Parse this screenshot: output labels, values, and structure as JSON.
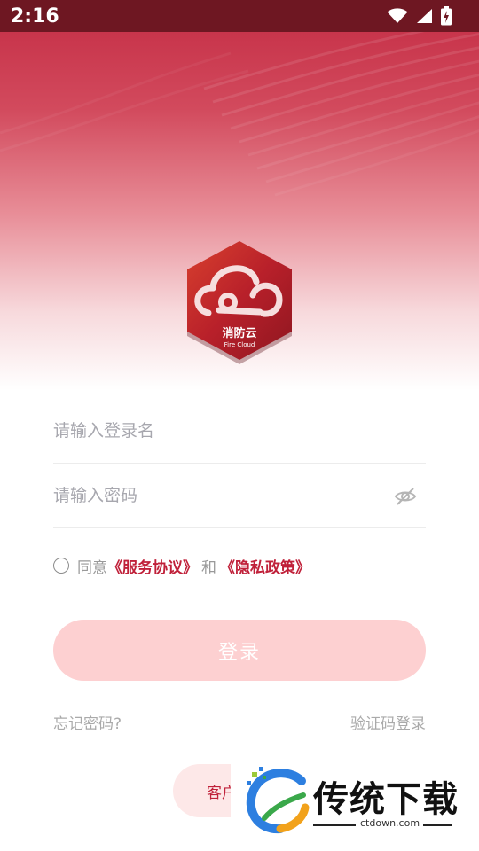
{
  "status_bar": {
    "time": "2:16"
  },
  "logo": {
    "name": "消防云",
    "subtitle": "Fire  Cloud"
  },
  "form": {
    "username_placeholder": "请输入登录名",
    "password_placeholder": "请输入密码"
  },
  "agreement": {
    "agree_text": "同意",
    "service_link": "《服务协议》",
    "and_text": "和",
    "privacy_link": "《隐私政策》"
  },
  "login_button": "登录",
  "forgot_password": "忘记密码?",
  "sms_login": "验证码登录",
  "customer_service_partial": "客户",
  "watermark": {
    "title": "传统下载",
    "url": "ctdown.com"
  },
  "colors": {
    "accent": "#c0213a",
    "button_bg": "#fdd0d1",
    "status_bar": "#6e1722"
  }
}
